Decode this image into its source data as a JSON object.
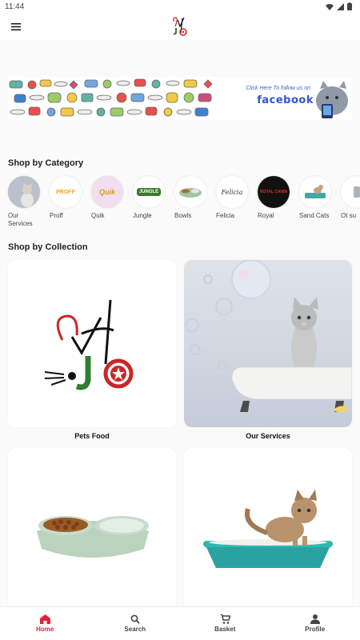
{
  "status_bar": {
    "time": "11:44"
  },
  "banner": {
    "text": "Click Here To follow us on",
    "brand": "facebook"
  },
  "shop_by_category": {
    "title": "Shop by Category",
    "items": [
      {
        "label": "Our Services",
        "icon": "cat-photo-icon"
      },
      {
        "label": "Proff",
        "icon": "proff-logo-icon"
      },
      {
        "label": "Quik",
        "icon": "quik-logo-icon"
      },
      {
        "label": "Jungle",
        "icon": "jungle-logo-icon"
      },
      {
        "label": "Bowls",
        "icon": "bowl-icon"
      },
      {
        "label": "Felicia",
        "icon": "felicia-logo-icon"
      },
      {
        "label": "Royal",
        "icon": "royal-canin-logo-icon"
      },
      {
        "label": "Sand Cats",
        "icon": "litter-box-icon"
      },
      {
        "label": "Ot su",
        "icon": "other-icon"
      }
    ]
  },
  "shop_by_collection": {
    "title": "Shop by Collection",
    "items": [
      {
        "label": "Pets Food"
      },
      {
        "label": "Our Services"
      },
      {
        "label": ""
      },
      {
        "label": ""
      }
    ]
  },
  "logos": {
    "proff": "PROFF",
    "quik": "Quik",
    "jungle": "JUNGLE",
    "felicia": "Felicia",
    "royal": "ROYAL CANIN",
    "vet_letters": "Vet",
    "jo_letters": "JO"
  },
  "bottom_nav": {
    "items": [
      {
        "label": "Home",
        "icon": "home-icon",
        "active": true
      },
      {
        "label": "Search",
        "icon": "search-icon",
        "active": false
      },
      {
        "label": "Basket",
        "icon": "basket-icon",
        "active": false
      },
      {
        "label": "Profile",
        "icon": "profile-icon",
        "active": false
      }
    ]
  },
  "colors": {
    "accent": "#e0233d",
    "background": "#fafafa"
  }
}
